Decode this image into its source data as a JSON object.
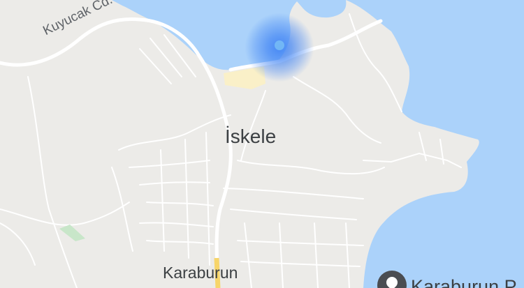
{
  "map": {
    "water_color": "#abd2fa",
    "land_color": "#ecebe8",
    "road_color": "#ffffff",
    "highlight_road_color": "#f7d56a",
    "built_area_color": "#faf0c8",
    "location_color": "#4285f4"
  },
  "labels": {
    "town": "İskele",
    "neighborhood": "Karaburun",
    "road": "Kuyucak Cd.",
    "poi_partial": "Karaburun P"
  },
  "icons": {
    "place_pin": "map-pin-icon",
    "location": "location-dot-icon"
  }
}
